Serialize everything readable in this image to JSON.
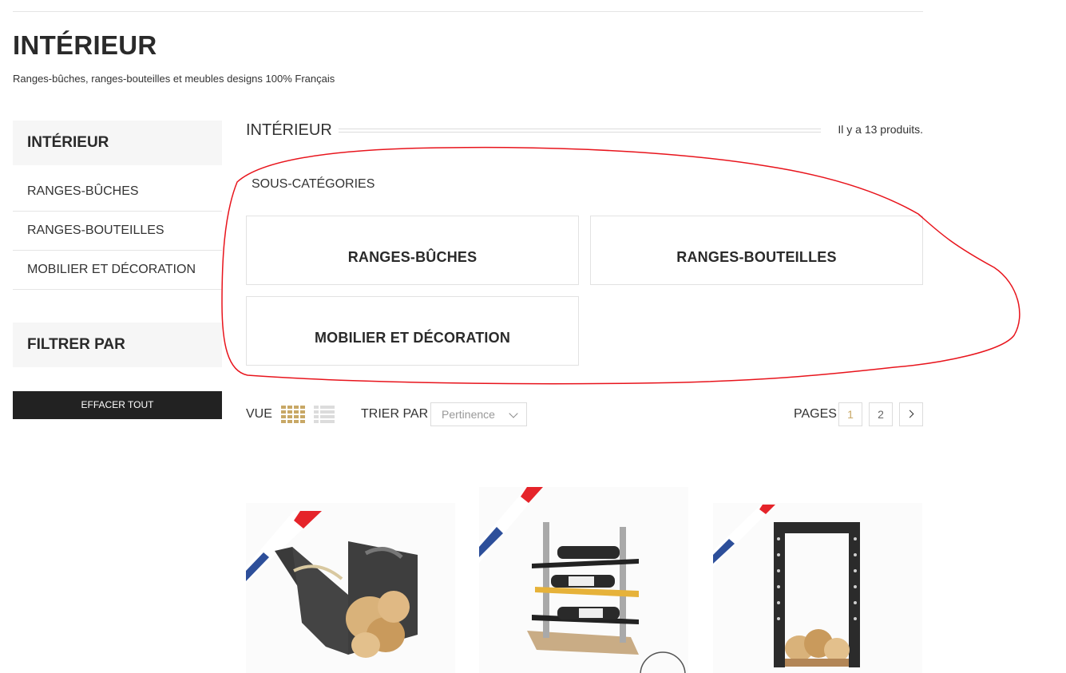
{
  "header": {
    "title": "INTÉRIEUR",
    "subtitle": "Ranges-bûches, ranges-bouteilles et meubles designs 100% Français"
  },
  "sidebar": {
    "category_title": "INTÉRIEUR",
    "items": [
      {
        "label": "RANGES-BÛCHES"
      },
      {
        "label": "RANGES-BOUTEILLES"
      },
      {
        "label": "MOBILIER ET DÉCORATION"
      }
    ],
    "filter_title": "FILTRER PAR",
    "clear_label": "EFFACER TOUT"
  },
  "main": {
    "category_title": "INTÉRIEUR",
    "product_count": "Il y a 13 produits.",
    "subcategories_heading": "SOUS-CATÉGORIES",
    "subcategories": [
      {
        "label": "RANGES-BÛCHES"
      },
      {
        "label": "RANGES-BOUTEILLES"
      },
      {
        "label": "MOBILIER ET DÉCORATION"
      }
    ]
  },
  "toolbar": {
    "view_label": "VUE",
    "sort_label": "TRIER PAR",
    "sort_value": "Pertinence",
    "pages_label": "PAGES",
    "pages": [
      "1",
      "2"
    ],
    "current_page": "1"
  },
  "products": [
    {
      "icon": "log-rack-basket-image"
    },
    {
      "icon": "wine-bottle-rack-image"
    },
    {
      "icon": "tall-log-rack-image"
    }
  ],
  "colors": {
    "accent": "#c8a866",
    "dark_button": "#222222",
    "annotation": "#e8141c",
    "flag_blue": "#2d4f9a",
    "flag_red": "#e5242a"
  }
}
